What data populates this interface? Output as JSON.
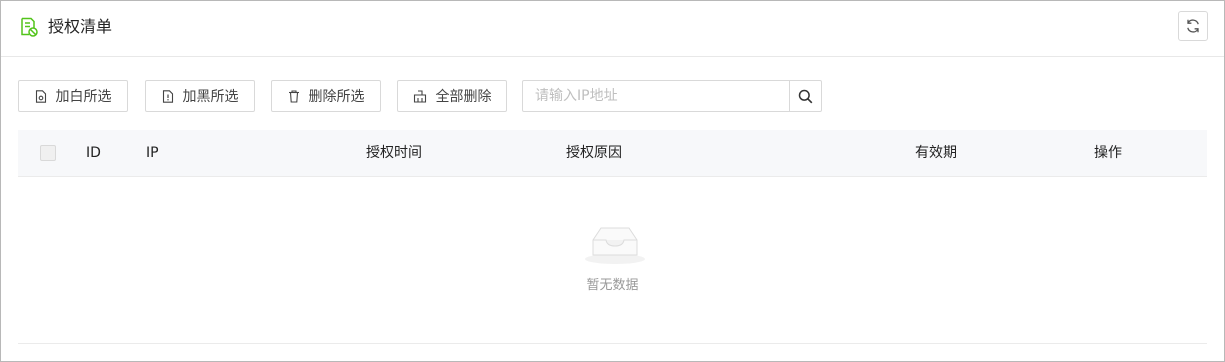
{
  "header": {
    "title": "授权清单",
    "title_icon": "document-shield-icon",
    "refresh_icon": "refresh-icon"
  },
  "toolbar": {
    "add_white_label": "加白所选",
    "add_black_label": "加黑所选",
    "delete_selected_label": "删除所选",
    "delete_all_label": "全部删除"
  },
  "search": {
    "placeholder": "请输入IP地址",
    "value": ""
  },
  "table": {
    "columns": {
      "id": "ID",
      "ip": "IP",
      "auth_time": "授权时间",
      "auth_reason": "授权原因",
      "validity": "有效期",
      "actions": "操作"
    },
    "rows": []
  },
  "empty": {
    "text": "暂无数据"
  },
  "colors": {
    "accent_green": "#52c41a",
    "header_bg": "#f7f8fa",
    "border": "#d9d9d9"
  }
}
